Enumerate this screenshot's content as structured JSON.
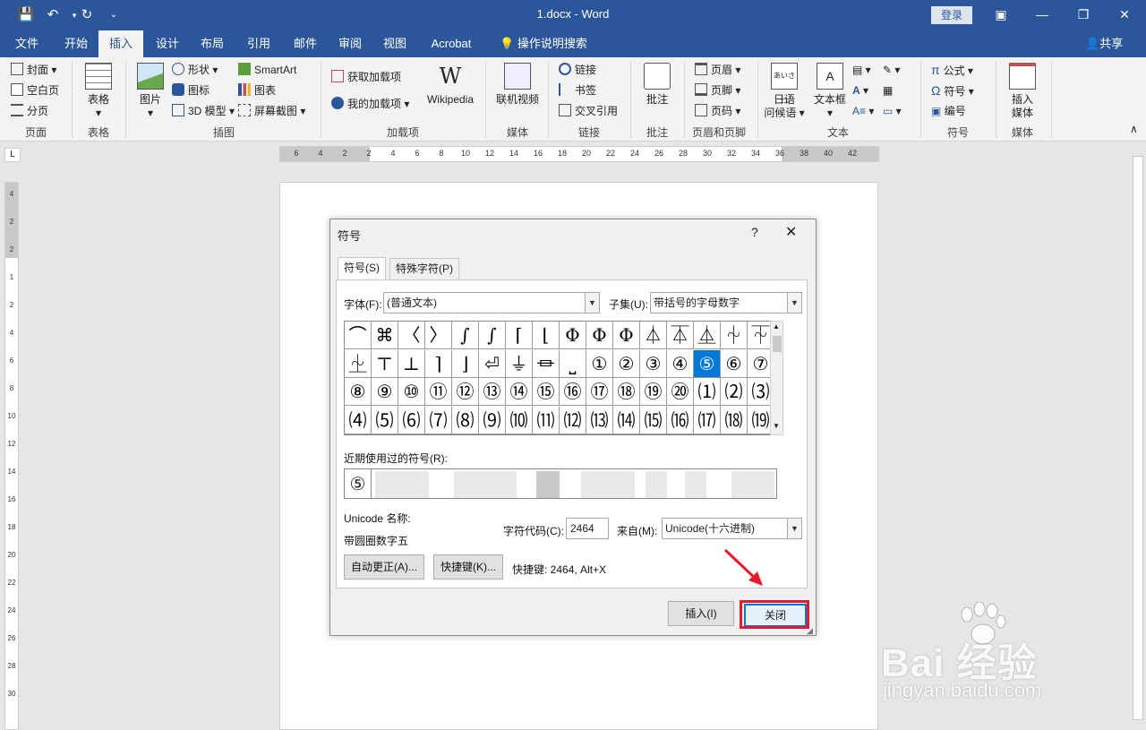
{
  "titlebar": {
    "doc_title": "1.docx  -  Word",
    "login": "登录"
  },
  "tabs": [
    "文件",
    "开始",
    "插入",
    "设计",
    "布局",
    "引用",
    "邮件",
    "审阅",
    "视图",
    "Acrobat"
  ],
  "active_tab": "插入",
  "tell_me": "操作说明搜索",
  "share": "共享",
  "ribbon": {
    "pages": {
      "cover": "封面",
      "blank": "空白页",
      "break": "分页",
      "label": "页面"
    },
    "table": {
      "btn": "表格",
      "label": "表格"
    },
    "illustrations": {
      "picture": "图片",
      "shapes": "形状",
      "icons": "图标",
      "model3d": "3D 模型",
      "smartart": "SmartArt",
      "chart": "图表",
      "screenshot": "屏幕截图",
      "label": "插图"
    },
    "addins": {
      "get": "获取加载项",
      "mine": "我的加载项",
      "wiki": "Wikipedia",
      "label": "加载项"
    },
    "media": {
      "video": "联机视频",
      "label": "媒体"
    },
    "links": {
      "link": "链接",
      "bookmark": "书签",
      "xref": "交叉引用",
      "label": "链接"
    },
    "comments": {
      "comment": "批注",
      "label": "批注"
    },
    "headerfooter": {
      "header": "页眉",
      "footer": "页脚",
      "pagenum": "页码",
      "label": "页眉和页脚"
    },
    "text": {
      "jp": "日语",
      "jp2": "问候语",
      "textbox": "文本框",
      "label": "文本"
    },
    "symbols": {
      "equation": "公式",
      "symbol": "符号",
      "number": "编号",
      "label": "符号"
    },
    "media2": {
      "insert": "插入",
      "insert2": "媒体",
      "label": "媒体"
    }
  },
  "ruler_h": [
    "6",
    "4",
    "2",
    "2",
    "4",
    "6",
    "8",
    "10",
    "12",
    "14",
    "16",
    "18",
    "20",
    "22",
    "24",
    "26",
    "28",
    "30",
    "32",
    "34",
    "36",
    "38",
    "40",
    "42"
  ],
  "ruler_v": [
    "4",
    "2",
    "2",
    "1",
    "2",
    "4",
    "6",
    "8",
    "10",
    "12",
    "14",
    "16",
    "18",
    "20",
    "22",
    "24",
    "26",
    "28",
    "30"
  ],
  "dialog": {
    "title": "符号",
    "help": "?",
    "close_x": "✕",
    "tab_symbols": "符号(S)",
    "tab_special": "特殊字符(P)",
    "font_label": "字体(F):",
    "font_value": "(普通文本)",
    "subset_label": "子集(U):",
    "subset_value": "带括号的字母数字",
    "grid": [
      [
        "⌒",
        "⌘",
        "〈",
        "〉",
        "∫",
        "∫",
        "⌈",
        "⌊",
        "Φ",
        "Φ",
        "Φ",
        "⏃",
        "⏄",
        "⏅",
        "⏆",
        "⏇"
      ],
      [
        "⏈",
        "⊤",
        "⊥",
        "⌉",
        "⌋",
        "⏎",
        "⏚",
        "⏛",
        "⎵",
        "①",
        "②",
        "③",
        "④",
        "⑤",
        "⑥",
        "⑦"
      ],
      [
        "⑧",
        "⑨",
        "⑩",
        "⑪",
        "⑫",
        "⑬",
        "⑭",
        "⑮",
        "⑯",
        "⑰",
        "⑱",
        "⑲",
        "⑳",
        "⑴",
        "⑵",
        "⑶"
      ],
      [
        "⑷",
        "⑸",
        "⑹",
        "⑺",
        "⑻",
        "⑼",
        "⑽",
        "⑾",
        "⑿",
        "⒀",
        "⒁",
        "⒂",
        "⒃",
        "⒄",
        "⒅",
        "⒆"
      ]
    ],
    "selected": "⑤",
    "recent_label": "近期使用过的符号(R):",
    "recent_first": "⑤",
    "unicode_name_label": "Unicode 名称:",
    "unicode_name": "带圆圈数字五",
    "code_label": "字符代码(C):",
    "code_value": "2464",
    "from_label": "来自(M):",
    "from_value": "Unicode(十六进制)",
    "autocorrect": "自动更正(A)...",
    "shortcut_btn": "快捷键(K)...",
    "shortcut_text": "快捷键: 2464, Alt+X",
    "insert": "插入(I)",
    "close": "关闭"
  },
  "watermark": {
    "brand": "Bai 经验",
    "url": "jingyan.baidu.com"
  },
  "colors": {
    "accent": "#2b579a",
    "selection": "#0078d7",
    "highlight": "#e8192c"
  }
}
